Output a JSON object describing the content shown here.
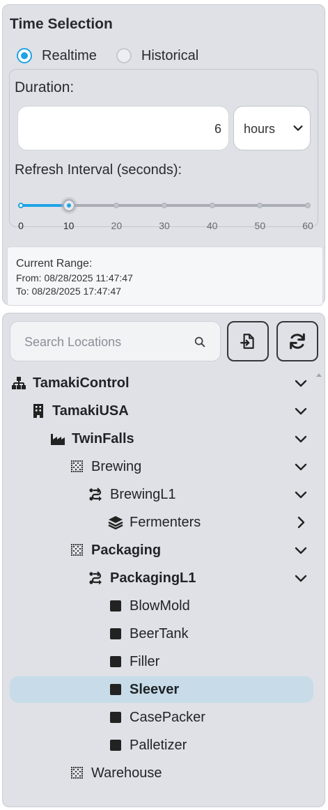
{
  "time_selection": {
    "title": "Time Selection",
    "modes": [
      {
        "label": "Realtime",
        "checked": true
      },
      {
        "label": "Historical",
        "checked": false
      }
    ],
    "duration_label": "Duration:",
    "duration_value": "6",
    "duration_unit": "hours",
    "refresh_label": "Refresh Interval (seconds):",
    "refresh_ticks": [
      "0",
      "10",
      "20",
      "30",
      "40",
      "50",
      "60"
    ],
    "refresh_value": 10,
    "refresh_max": 60,
    "current_range_label": "Current Range:",
    "from_text": "From: 08/28/2025 11:47:47",
    "to_text": "To: 08/28/2025 17:47:47"
  },
  "locations": {
    "search_placeholder": "Search Locations",
    "tree": [
      {
        "label": "TamakiControl",
        "icon": "hierarchy-icon",
        "bold": true,
        "chevron": "down"
      },
      {
        "label": "TamakiUSA",
        "icon": "building-icon",
        "bold": true,
        "chevron": "down"
      },
      {
        "label": "TwinFalls",
        "icon": "factory-icon",
        "bold": true,
        "chevron": "down"
      },
      {
        "label": "Brewing",
        "icon": "area-grid-icon",
        "bold": false,
        "chevron": "down"
      },
      {
        "label": "BrewingL1",
        "icon": "line-flow-icon",
        "bold": false,
        "chevron": "down"
      },
      {
        "label": "Fermenters",
        "icon": "layers-icon",
        "bold": false,
        "chevron": "right"
      },
      {
        "label": "Packaging",
        "icon": "area-grid-icon",
        "bold": true,
        "chevron": "down"
      },
      {
        "label": "PackagingL1",
        "icon": "line-flow-icon",
        "bold": true,
        "chevron": "down"
      },
      {
        "label": "BlowMold",
        "icon": "cell-square-icon",
        "bold": false,
        "chevron": ""
      },
      {
        "label": "BeerTank",
        "icon": "cell-square-icon",
        "bold": false,
        "chevron": ""
      },
      {
        "label": "Filler",
        "icon": "cell-square-icon",
        "bold": false,
        "chevron": ""
      },
      {
        "label": "Sleever",
        "icon": "cell-square-icon",
        "bold": true,
        "chevron": "",
        "selected": true
      },
      {
        "label": "CasePacker",
        "icon": "cell-square-icon",
        "bold": false,
        "chevron": ""
      },
      {
        "label": "Palletizer",
        "icon": "cell-square-icon",
        "bold": false,
        "chevron": ""
      },
      {
        "label": "Warehouse",
        "icon": "area-grid-icon",
        "bold": false,
        "chevron": ""
      }
    ]
  },
  "colors": {
    "accent": "#1fa3e6",
    "panel": "#dfe1e6",
    "selected_row": "#c7dce8"
  }
}
